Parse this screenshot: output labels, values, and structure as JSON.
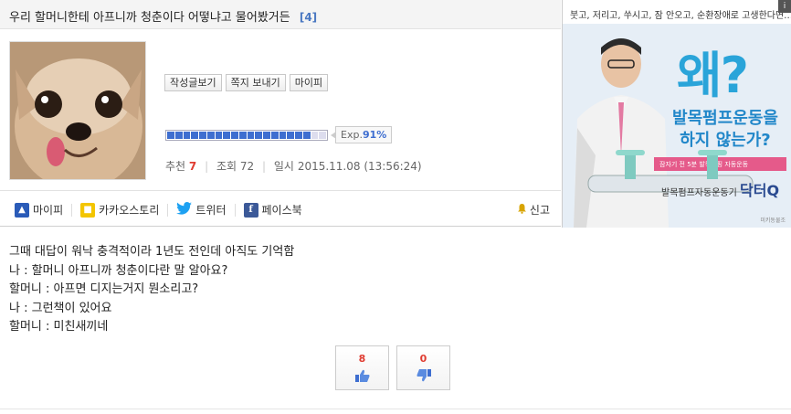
{
  "post": {
    "title": "우리 할머니한테 아프니까 청춘이다 어떻냐고 물어봤거든",
    "comment_count": "[4]"
  },
  "profile": {
    "buttons": [
      "작성글보기",
      "쪽지 보내기",
      "마이피"
    ],
    "exp_prefix": "Exp.",
    "exp_value": "91%",
    "exp_fraction": 0.91,
    "recommend_label": "추천",
    "recommend_value": "7",
    "views_label": "조회",
    "views_value": "72",
    "date_label": "일시",
    "date_value": "2015.11.08 (13:56:24)"
  },
  "share": {
    "mypi": "마이피",
    "kakao": "카카오스토리",
    "twitter": "트위터",
    "facebook": "페이스북",
    "report": "신고"
  },
  "ad": {
    "top_text": "붓고, 저리고, 쑤시고, 잠 안오고, 순환장애로 고생한다면…",
    "why": "왜?",
    "main_line1": "발목펌프운동을",
    "main_line2": "하지 않는가?",
    "pink_text": "잠자기 전 5분 발목펌핑 자동운동",
    "brand_prefix": "발목펌프자동운동기",
    "brand_name": "닥터Q",
    "small": "미키동물조"
  },
  "content": {
    "lines": [
      "그때 대답이 워낙 충격적이라 1년도 전인데 아직도 기억함",
      "나 : 할머니 아프니까 청춘이다란 말 알아요?",
      "할머니 : 아프면 디지는거지 뭔소리고?",
      "나 : 그런책이 있어요",
      "할머니 : 미친새끼네"
    ]
  },
  "votes": {
    "up": "8",
    "down": "0"
  },
  "colors": {
    "accent_blue": "#3e6ed0",
    "accent_red": "#e03c31",
    "ad_blue": "#2aa4d9"
  }
}
